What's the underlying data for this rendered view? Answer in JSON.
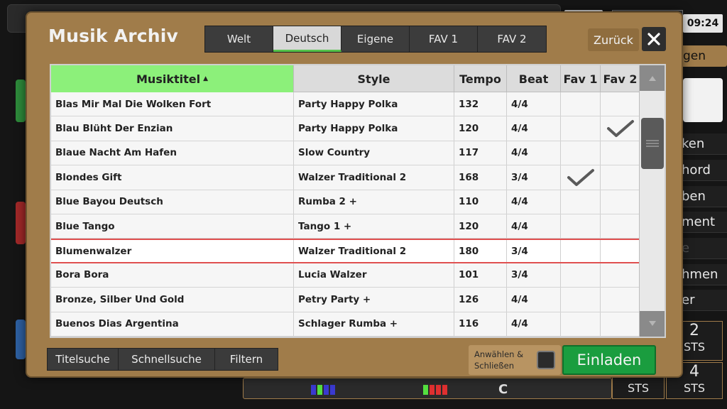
{
  "dialog": {
    "title": "Musik Archiv",
    "tabs": [
      {
        "label": "Welt",
        "active": false
      },
      {
        "label": "Deutsch",
        "active": true
      },
      {
        "label": "Eigene",
        "active": false
      },
      {
        "label": "FAV 1",
        "active": false
      },
      {
        "label": "FAV 2",
        "active": false
      }
    ],
    "back_label": "Zurück",
    "close_icon": "close-icon"
  },
  "table": {
    "columns": [
      "Musiktitel",
      "Style",
      "Tempo",
      "Beat",
      "Fav 1",
      "Fav 2"
    ],
    "sorted_column": "Musiktitel",
    "sort_direction": "ascending",
    "rows": [
      {
        "title": "Blas Mir Mal Die Wolken Fort",
        "style": "Party Happy Polka",
        "tempo": "132",
        "beat": "4/4",
        "fav1": false,
        "fav2": false
      },
      {
        "title": "Blau Blüht Der Enzian",
        "style": "Party Happy Polka",
        "tempo": "120",
        "beat": "4/4",
        "fav1": false,
        "fav2": true
      },
      {
        "title": "Blaue Nacht Am Hafen",
        "style": "Slow Country",
        "tempo": "117",
        "beat": "4/4",
        "fav1": false,
        "fav2": false
      },
      {
        "title": "Blondes Gift",
        "style": "Walzer Traditional 2",
        "tempo": "168",
        "beat": "3/4",
        "fav1": true,
        "fav2": false
      },
      {
        "title": "Blue Bayou Deutsch",
        "style": "Rumba 2 +",
        "tempo": "110",
        "beat": "4/4",
        "fav1": false,
        "fav2": false
      },
      {
        "title": "Blue Tango",
        "style": "Tango 1 +",
        "tempo": "120",
        "beat": "4/4",
        "fav1": false,
        "fav2": false
      },
      {
        "title": "Blumenwalzer",
        "style": "Walzer Traditional 2",
        "tempo": "180",
        "beat": "3/4",
        "fav1": false,
        "fav2": false,
        "selected": true
      },
      {
        "title": "Bora Bora",
        "style": "Lucia Walzer",
        "tempo": "101",
        "beat": "3/4",
        "fav1": false,
        "fav2": false
      },
      {
        "title": "Bronze, Silber Und Gold",
        "style": "Petry Party +",
        "tempo": "126",
        "beat": "4/4",
        "fav1": false,
        "fav2": false
      },
      {
        "title": "Buenos Dias Argentina",
        "style": "Schlager Rumba +",
        "tempo": "116",
        "beat": "4/4",
        "fav1": false,
        "fav2": false
      }
    ]
  },
  "footer": {
    "search_tabs": [
      "Titelsuche",
      "Schnellsuche",
      "Filtern"
    ],
    "select_close_label_1": "Anwählen &",
    "select_close_label_2": "Schließen",
    "select_close_checked": false,
    "load_label": "Einladen"
  },
  "background": {
    "clock": "09:24",
    "tan_button_label": "gen",
    "right_labels": [
      "ken",
      "hord",
      "ben",
      "ment",
      "e",
      "hmen",
      "er"
    ],
    "sts_top_number": "2",
    "sts_bottom_number": "4",
    "sts_label": "STS",
    "chord": "C"
  },
  "colors": {
    "dialog_bg": "#a07c4a",
    "active_tab_accent": "#55c34a",
    "sorted_header": "#8cf07a",
    "selected_row_border": "#e05050",
    "load_button": "#1a9d3f"
  }
}
